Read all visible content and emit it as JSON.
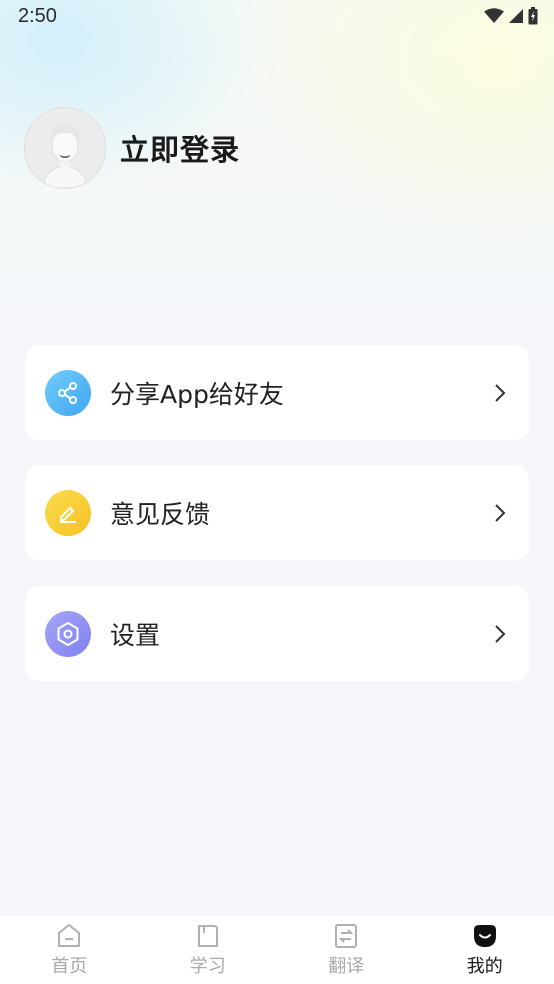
{
  "status_bar": {
    "time": "2:50",
    "icons": [
      "wifi-icon",
      "signal-icon",
      "battery-icon"
    ]
  },
  "profile": {
    "login_label": "立即登录",
    "avatar_icon": "default-avatar"
  },
  "menu": {
    "items": [
      {
        "label": "分享App给好友",
        "icon": "share-icon",
        "color": "#4fb3f5"
      },
      {
        "label": "意见反馈",
        "icon": "edit-icon",
        "color": "#f7cb2f"
      },
      {
        "label": "设置",
        "icon": "hexagon-settings-icon",
        "color": "#8f8ef2"
      }
    ]
  },
  "tab_bar": {
    "tabs": [
      {
        "label": "首页",
        "icon": "home-icon",
        "active": false
      },
      {
        "label": "学习",
        "icon": "book-icon",
        "active": false
      },
      {
        "label": "翻译",
        "icon": "translate-icon",
        "active": false
      },
      {
        "label": "我的",
        "icon": "profile-face-icon",
        "active": true
      }
    ],
    "active_color": "#1a1a1a",
    "inactive_color": "#a9a9a9"
  }
}
